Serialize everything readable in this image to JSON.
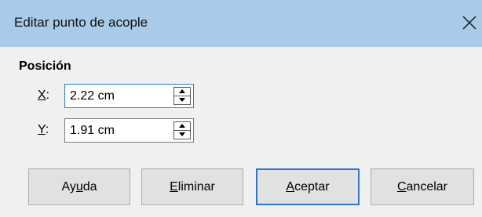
{
  "dialog": {
    "title": "Editar punto de acople",
    "close_glyph": "✕"
  },
  "position": {
    "section_title": "Posición",
    "x": {
      "label_mnemonic": "X",
      "label_rest": ":",
      "value": "2.22 cm"
    },
    "y": {
      "label_mnemonic": "Y",
      "label_rest": ":",
      "value": "1.91 cm"
    }
  },
  "buttons": {
    "help": {
      "pre": "Ay",
      "mnemonic": "u",
      "post": "da"
    },
    "delete": {
      "pre": "",
      "mnemonic": "E",
      "post": "liminar"
    },
    "ok": {
      "pre": "",
      "mnemonic": "A",
      "post": "ceptar"
    },
    "cancel": {
      "pre": "",
      "mnemonic": "C",
      "post": "ancelar"
    }
  },
  "colors": {
    "titlebar": "#a9cbe9",
    "dialog_bg": "#f0f0f0",
    "focus_accent": "#2a78d2"
  }
}
